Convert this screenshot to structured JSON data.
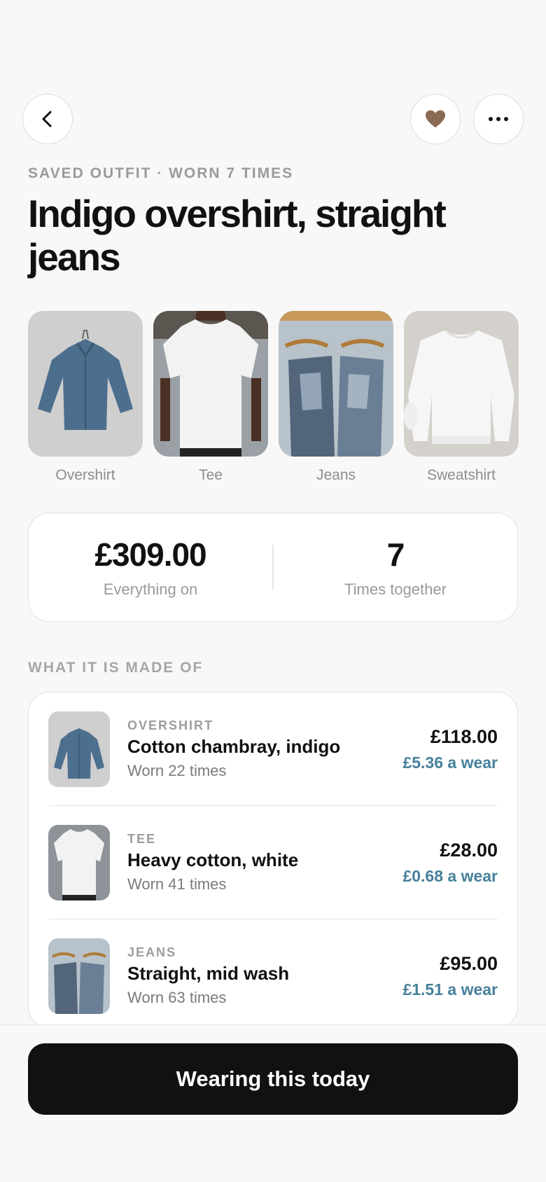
{
  "header": {
    "back_icon": "chevron-left-icon",
    "favorite_icon": "heart-icon",
    "more_icon": "ellipsis-icon",
    "eyebrow": "SAVED OUTFIT · WORN 7 TIMES",
    "title": "Indigo overshirt, straight jeans"
  },
  "outfit_items": [
    {
      "label": "Overshirt"
    },
    {
      "label": "Tee"
    },
    {
      "label": "Jeans"
    },
    {
      "label": "Sweatshirt"
    }
  ],
  "stats": {
    "total": {
      "value": "£309.00",
      "caption": "Everything on"
    },
    "times": {
      "value": "7",
      "caption": "Times together"
    }
  },
  "section_title": "WHAT IT IS MADE OF",
  "items": [
    {
      "category": "OVERSHIRT",
      "name": "Cotton chambray, indigo",
      "worn": "Worn 22 times",
      "price": "£118.00",
      "per_wear": "£5.36 a wear"
    },
    {
      "category": "TEE",
      "name": "Heavy cotton, white",
      "worn": "Worn 41 times",
      "price": "£28.00",
      "per_wear": "£0.68 a wear"
    },
    {
      "category": "JEANS",
      "name": "Straight, mid wash",
      "worn": "Worn 63 times",
      "price": "£95.00",
      "per_wear": "£1.51 a wear"
    }
  ],
  "cta": {
    "label": "Wearing this today"
  },
  "colors": {
    "accent_heart": "#8a6a52",
    "per_wear_text": "#46809a",
    "cta_bg": "#111111"
  }
}
